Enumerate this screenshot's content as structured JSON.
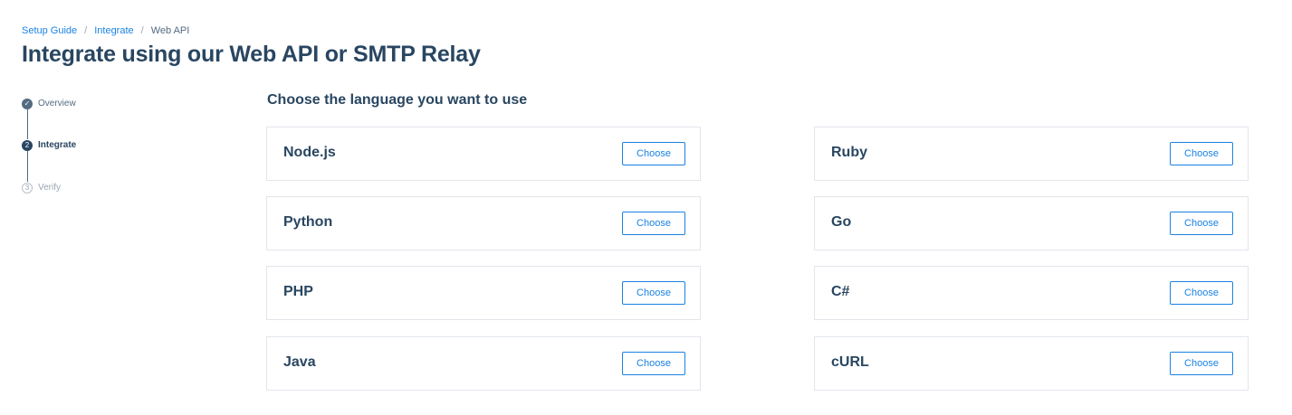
{
  "breadcrumb": {
    "items": [
      {
        "label": "Setup Guide"
      },
      {
        "label": "Integrate"
      }
    ],
    "separator": "/",
    "current": "Web API"
  },
  "page_title": "Integrate using our Web API or SMTP Relay",
  "stepper": {
    "steps": [
      {
        "label": "Overview",
        "state": "done",
        "marker": "✓"
      },
      {
        "label": "Integrate",
        "state": "active",
        "marker": "2"
      },
      {
        "label": "Verify",
        "state": "pending",
        "marker": "3"
      }
    ]
  },
  "section_heading": "Choose the language you want to use",
  "languages": {
    "left": [
      {
        "name": "Node.js",
        "button": "Choose"
      },
      {
        "name": "Python",
        "button": "Choose"
      },
      {
        "name": "PHP",
        "button": "Choose"
      },
      {
        "name": "Java",
        "button": "Choose"
      }
    ],
    "right": [
      {
        "name": "Ruby",
        "button": "Choose"
      },
      {
        "name": "Go",
        "button": "Choose"
      },
      {
        "name": "C#",
        "button": "Choose"
      },
      {
        "name": "cURL",
        "button": "Choose"
      }
    ]
  },
  "colors": {
    "accent": "#1a82e2",
    "heading": "#294661",
    "muted": "#546b81",
    "border": "#e1e6eb"
  }
}
